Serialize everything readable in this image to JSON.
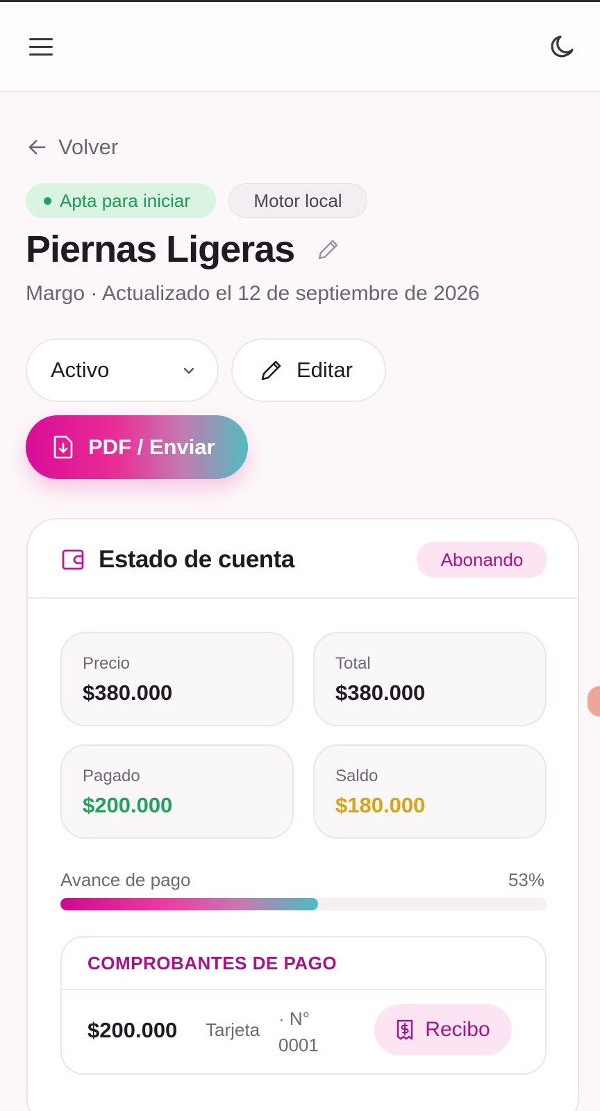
{
  "topbar": {
    "menu_icon": "hamburger-menu-icon",
    "theme_icon": "moon-icon"
  },
  "nav": {
    "back_label": "Volver",
    "back_icon": "arrow-left-icon"
  },
  "chips": {
    "status": "Apta para iniciar",
    "engine": "Motor local"
  },
  "header": {
    "title": "Piernas Ligeras",
    "subtitle": "Margo · Actualizado el 12 de septiembre de 2026"
  },
  "actions": {
    "status_value": "Activo",
    "edit_label": "Editar",
    "pdf_label": "PDF / Enviar"
  },
  "account": {
    "title": "Estado de cuenta",
    "badge": "Abonando",
    "stats": [
      {
        "label": "Precio",
        "value": "$380.000"
      },
      {
        "label": "Total",
        "value": "$380.000"
      },
      {
        "label": "Pagado",
        "value": "$200.000"
      },
      {
        "label": "Saldo",
        "value": "$180.000"
      }
    ],
    "progress": {
      "label": "Avance de pago",
      "percent_text": "53%",
      "value": 0.53
    },
    "receipts": {
      "title": "COMPROBANTES DE PAGO",
      "items": [
        {
          "amount": "$200.000",
          "method": "Tarjeta",
          "number": "· N° 0001",
          "button": "Recibo"
        }
      ]
    }
  },
  "colors": {
    "accent": "#a8128a",
    "paid": "#1fa35a",
    "balance": "#d9a414",
    "status_green": "#1d9b52"
  }
}
